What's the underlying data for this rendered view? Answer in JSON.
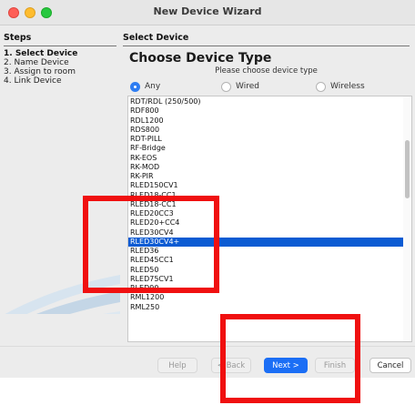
{
  "window": {
    "title": "New Device Wizard"
  },
  "sidebar": {
    "title": "Steps",
    "steps": [
      {
        "number": "1.",
        "label": "Select Device"
      },
      {
        "number": "2.",
        "label": "Name Device"
      },
      {
        "number": "3.",
        "label": "Assign to room"
      },
      {
        "number": "4.",
        "label": "Link Device"
      }
    ],
    "active_step": 0
  },
  "main": {
    "section_title": "Select Device",
    "heading": "Choose Device Type",
    "prompt": "Please choose device type",
    "radios": [
      {
        "label": "Any",
        "checked": true
      },
      {
        "label": "Wired",
        "checked": false
      },
      {
        "label": "Wireless",
        "checked": false
      }
    ],
    "devices": [
      "RDT/RDL (250/500)",
      "RDF800",
      "RDL1200",
      "RDS800",
      "RDT-PILL",
      "RF-Bridge",
      "RK-EOS",
      "RK-MOD",
      "RK-PIR",
      "RLED150CV1",
      "RLED18-CC1",
      "RLED18-CC1",
      "RLED20CC3",
      "RLED20+CC4",
      "RLED30CV4",
      "RLED30CV4+",
      "RLED36",
      "RLED45CC1",
      "RLED50",
      "RLED75CV1",
      "RLED90",
      "RML1200",
      "RML250"
    ],
    "selected_device": 15
  },
  "footer": {
    "help": "Help",
    "back": "< Back",
    "next": "Next >",
    "finish": "Finish",
    "cancel": "Cancel"
  },
  "colors": {
    "selection": "#0b5bd3",
    "primary_button": "#1b6ef5",
    "annotation": "#f01010"
  }
}
